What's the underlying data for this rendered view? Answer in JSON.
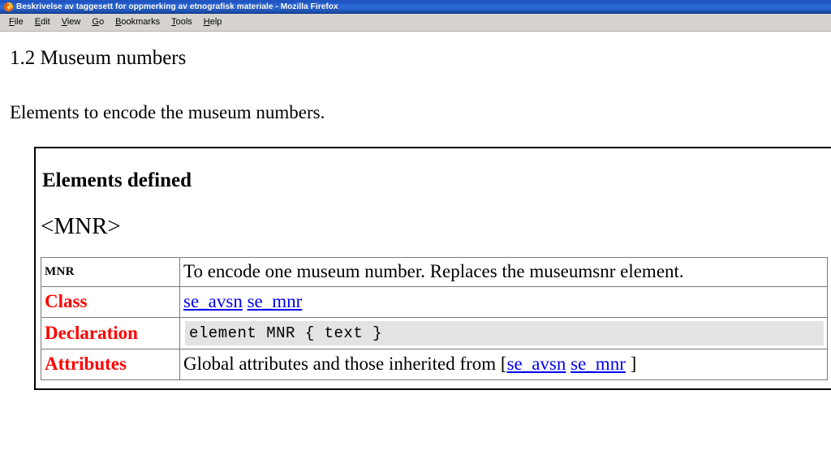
{
  "window": {
    "title": "Beskrivelse av taggesett for oppmerking av etnografisk materiale - Mozilla Firefox",
    "app_icon": "firefox-icon"
  },
  "menubar": {
    "items": [
      {
        "label": "File",
        "accel": "F"
      },
      {
        "label": "Edit",
        "accel": "E"
      },
      {
        "label": "View",
        "accel": "V"
      },
      {
        "label": "Go",
        "accel": "G"
      },
      {
        "label": "Bookmarks",
        "accel": "B"
      },
      {
        "label": "Tools",
        "accel": "T"
      },
      {
        "label": "Help",
        "accel": "H"
      }
    ]
  },
  "page": {
    "section_heading": "1.2 Museum numbers",
    "intro_paragraph": "Elements to encode the museum numbers.",
    "box": {
      "heading": "Elements defined",
      "element_name": "<MNR>",
      "table": {
        "rows": [
          {
            "label": "MNR",
            "label_style": "black",
            "value_type": "text",
            "value": "To encode one museum number. Replaces the museumsnr element."
          },
          {
            "label": "Class",
            "label_style": "red",
            "value_type": "links",
            "links": [
              {
                "text": "se_avsn"
              },
              {
                "text": "se_mnr"
              }
            ]
          },
          {
            "label": "Declaration",
            "label_style": "red",
            "value_type": "code",
            "value": "element MNR { text }"
          },
          {
            "label": "Attributes",
            "label_style": "red",
            "value_type": "text_with_links",
            "prefix": "Global attributes and those inherited from [",
            "links": [
              {
                "text": "se_avsn"
              },
              {
                "text": "se_mnr"
              }
            ],
            "suffix": " ]"
          }
        ]
      }
    }
  },
  "colors": {
    "titlebar_blue": "#2f6bd6",
    "menubar_gray": "#d6d3ce",
    "label_red": "#ff0000",
    "link_blue": "#0000ee",
    "code_bg": "#e3e3e3",
    "page_bg": "#ffffff"
  }
}
